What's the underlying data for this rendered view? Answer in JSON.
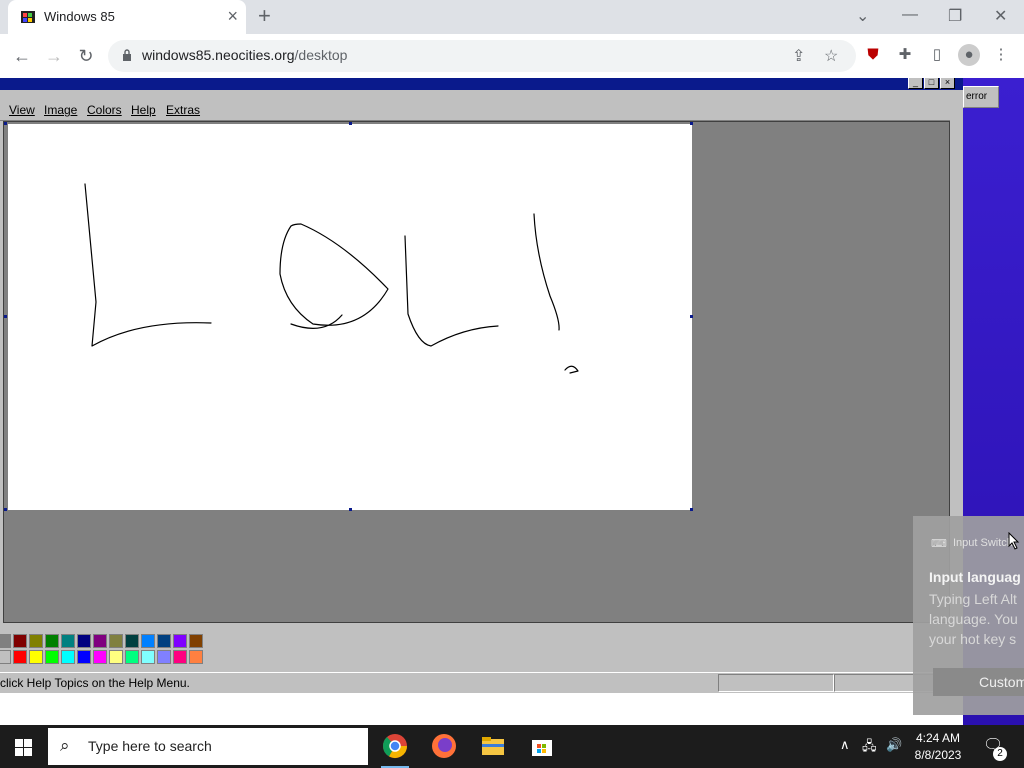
{
  "browser": {
    "tab_title": "Windows 85",
    "url_domain": "windows85.neocities.org",
    "url_path": "/desktop"
  },
  "paint": {
    "menus": [
      "View",
      "Image",
      "Colors",
      "Help",
      "Extras"
    ],
    "status_text": "click Help Topics on the Help Menu.",
    "palette_top": [
      "#808080",
      "#800000",
      "#808000",
      "#008000",
      "#008080",
      "#000080",
      "#800080",
      "#808040",
      "#004040",
      "#0080ff",
      "#004080",
      "#8000ff",
      "#804000"
    ],
    "palette_bottom": [
      "#c0c0c0",
      "#ff0000",
      "#ffff00",
      "#00ff00",
      "#00ffff",
      "#0000ff",
      "#ff00ff",
      "#ffff80",
      "#00ff80",
      "#80ffff",
      "#8080ff",
      "#ff0080",
      "#ff8040"
    ]
  },
  "desktop": {
    "error_button": "error"
  },
  "toast": {
    "header": "Input Switch",
    "title": "Input languag",
    "body_lines": [
      "Typing Left Alt",
      "language. You",
      "your hot key s"
    ],
    "button": "Custom"
  },
  "taskbar": {
    "search_placeholder": "Type here to search",
    "time": "4:24 AM",
    "date": "8/8/2023",
    "notification_count": "2"
  }
}
